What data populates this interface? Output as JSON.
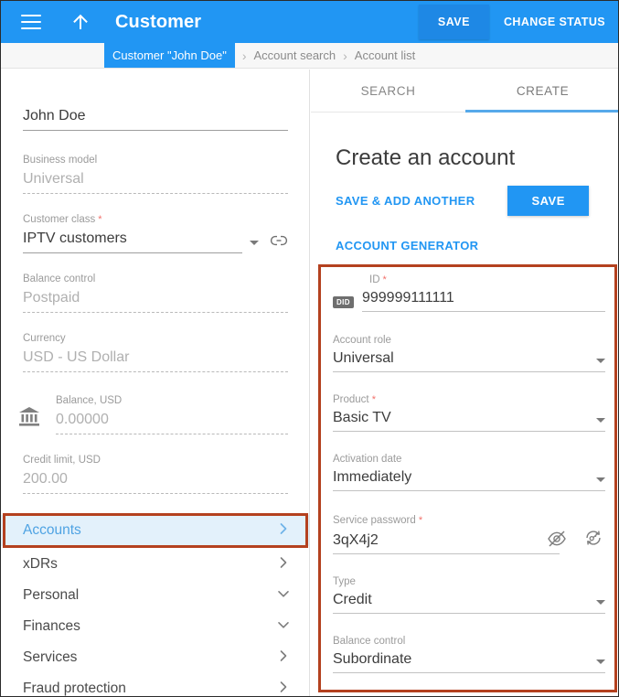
{
  "header": {
    "title": "Customer",
    "menu_icon": "hamburger-menu-icon",
    "up_icon": "arrow-up-icon",
    "save_label": "SAVE",
    "change_status_label": "CHANGE STATUS"
  },
  "breadcrumb": {
    "active": "Customer \"John Doe\"",
    "separator": "›",
    "items": [
      "Account search",
      "Account list"
    ]
  },
  "left_panel": {
    "customer_name": "John Doe",
    "fields": [
      {
        "label": "Business model",
        "value": "Universal",
        "required": false
      },
      {
        "label": "Customer class",
        "value": "IPTV customers",
        "required": true
      },
      {
        "label": "Balance control",
        "value": "Postpaid",
        "required": false
      },
      {
        "label": "Currency",
        "value": "USD - US Dollar",
        "required": false
      },
      {
        "label": "Balance, USD",
        "value": "0.00000",
        "required": false
      },
      {
        "label": "Credit limit, USD",
        "value": "200.00",
        "required": false
      }
    ],
    "balance_icon": "bank-icon",
    "link_icon": "link-icon",
    "dropdown_icon": "chevron-down-icon",
    "nav": [
      {
        "label": "Accounts",
        "chevron": "chevron-right",
        "active": true
      },
      {
        "label": "xDRs",
        "chevron": "chevron-right",
        "active": false
      },
      {
        "label": "Personal",
        "chevron": "chevron-down",
        "active": false
      },
      {
        "label": "Finances",
        "chevron": "chevron-down",
        "active": false
      },
      {
        "label": "Services",
        "chevron": "chevron-right",
        "active": false
      },
      {
        "label": "Fraud protection",
        "chevron": "chevron-right",
        "active": false
      }
    ]
  },
  "right_panel": {
    "tabs": [
      {
        "label": "SEARCH",
        "active": false
      },
      {
        "label": "CREATE",
        "active": true
      }
    ],
    "title": "Create an account",
    "save_add_another_label": "SAVE & ADD ANOTHER",
    "save_label": "SAVE",
    "account_generator_label": "ACCOUNT GENERATOR",
    "id_badge": "DID",
    "fields": [
      {
        "label": "ID",
        "value": "999999111111",
        "required": true
      },
      {
        "label": "Account role",
        "value": "Universal",
        "required": false
      },
      {
        "label": "Product",
        "value": "Basic TV",
        "required": true
      },
      {
        "label": "Activation date",
        "value": "Immediately",
        "required": false
      },
      {
        "label": "Service password",
        "value": "3qX4j2",
        "required": true
      },
      {
        "label": "Type",
        "value": "Credit",
        "required": false
      },
      {
        "label": "Balance control",
        "value": "Subordinate",
        "required": false
      }
    ],
    "eye_icon": "eye-off-icon",
    "regenerate_icon": "regenerate-password-icon"
  },
  "colors": {
    "accent_blue": "#2196f3",
    "highlight_border": "#b4411f",
    "active_row_bg": "#e3f1fb",
    "required_star": "#f2716b"
  }
}
